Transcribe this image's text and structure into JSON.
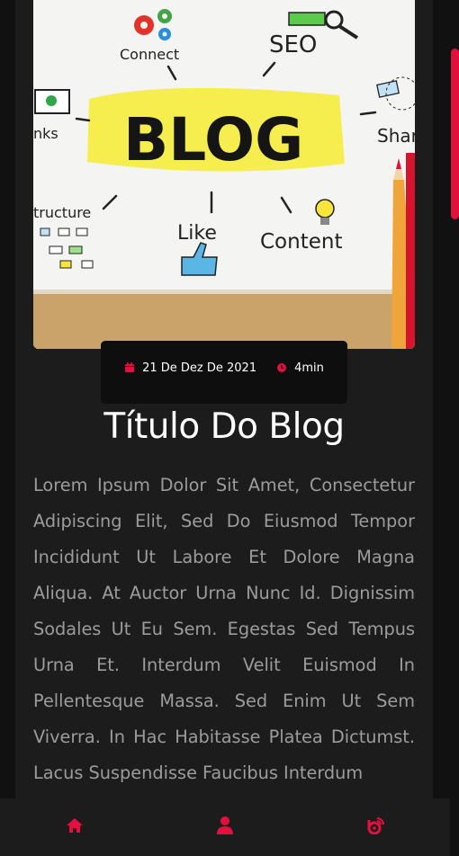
{
  "post": {
    "date": "21 De Dez De 2021",
    "read_time": "4min",
    "title": "Título Do Blog",
    "body": "Lorem Ipsum Dolor Sit Amet, Consectetur Adipiscing Elit, Sed Do Eiusmod Tempor Incididunt Ut Labore Et Dolore Magna Aliqua. At Auctor Urna Nunc Id. Dignissim Sodales Ut Eu Sem. Egestas Sed Tempus Urna Et. Interdum Velit Euismod In Pellentesque Massa. Sed Enim Ut Sem Viverra. In Hac Habitasse Platea Dictumst. Lacus Suspendisse Faucibus Interdum"
  },
  "hero_image": {
    "words": {
      "blog": "BLOG",
      "connect": "Connect",
      "seo": "SEO",
      "links": "nks",
      "share": "Shar",
      "structure": "tructure",
      "like": "Like",
      "content": "Content"
    }
  },
  "nav": {
    "items": [
      {
        "icon": "home-icon"
      },
      {
        "icon": "user-icon"
      },
      {
        "icon": "blog-icon"
      }
    ]
  },
  "colors": {
    "accent": "#e3103f",
    "background": "#111111",
    "card": "#1c1c1d",
    "meta_box": "#0e0e0e",
    "title": "#ffffff",
    "body_text": "#9c9c9c"
  }
}
